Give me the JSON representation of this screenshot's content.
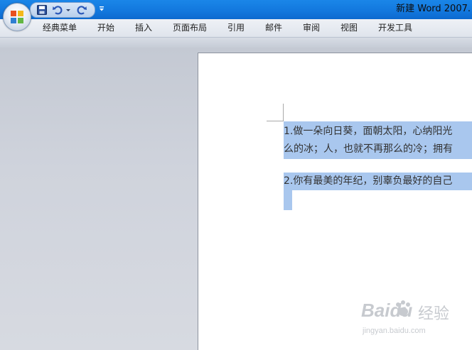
{
  "window": {
    "title": "新建 Word 2007."
  },
  "quick_access": {
    "buttons": [
      "save-icon",
      "undo-icon",
      "undo-dropdown-icon",
      "redo-icon"
    ],
    "customize_icon": "customize-dropdown-icon"
  },
  "ribbon": {
    "tabs": [
      "经典菜单",
      "开始",
      "插入",
      "页面布局",
      "引用",
      "邮件",
      "审阅",
      "视图",
      "开发工具"
    ]
  },
  "document": {
    "lines": [
      "1.做一朵向日葵，面朝太阳，心纳阳光",
      "么的冰；人，也就不再那么的冷；拥有",
      "",
      "2.你有最美的年纪，别辜负最好的自己"
    ],
    "selection_color": "#a9c7ee"
  },
  "watermark": {
    "brand": "Baidu",
    "brand_cn": "经验",
    "url": "jingyan.baidu.com"
  },
  "colors": {
    "titlebar": "#1277dd",
    "workspace": "#cfd3dc",
    "page": "#ffffff"
  }
}
